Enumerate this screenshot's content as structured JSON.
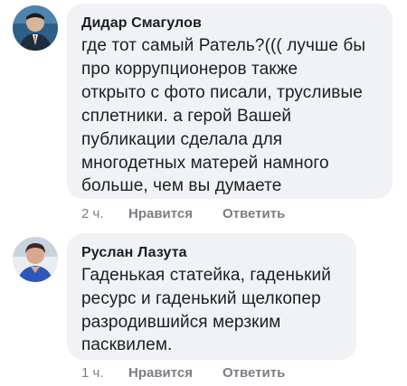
{
  "comments": [
    {
      "author": "Дидар Смагулов",
      "lines": [
        "где тот самый Ратель?((( лучше бы",
        "про коррупционеров также",
        "открыто с фото писали, трусливые",
        "сплетники. а герой Вашей",
        "публикации сделала для",
        "многодетных матерей намного",
        "больше, чем вы думаете"
      ],
      "time": "2 ч.",
      "like_label": "Нравится",
      "reply_label": "Ответить"
    },
    {
      "author": "Руслан Лазута",
      "lines": [
        "Гаденькая статейка, гаденький",
        "ресурс и гаденький щелкопер",
        "разродившийся мерзким",
        "пасквилем."
      ],
      "time": "1 ч.",
      "like_label": "Нравится",
      "reply_label": "Ответить"
    }
  ],
  "colors": {
    "bubble": "#f0f2f5",
    "text": "#1c1e21",
    "meta": "#7a7e84"
  },
  "icons": [
    "avatar-didar",
    "avatar-ruslan"
  ]
}
